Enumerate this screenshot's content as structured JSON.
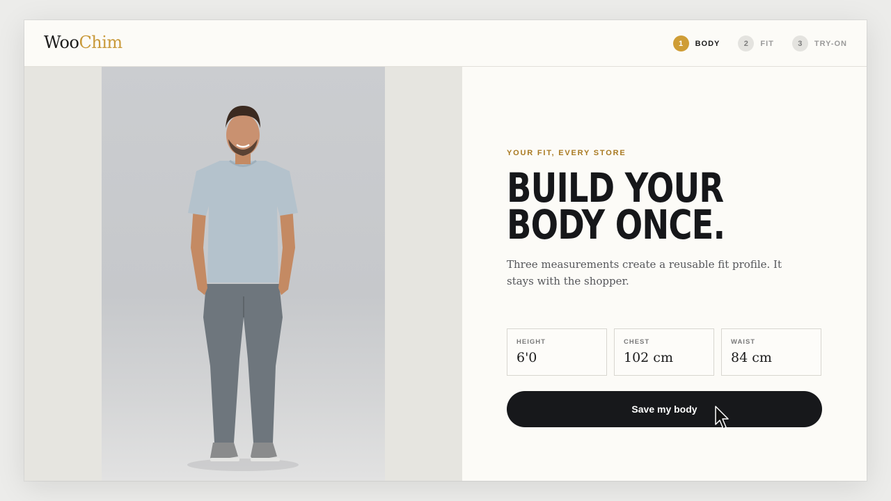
{
  "header": {
    "logo_primary": "Woo",
    "logo_accent": "Chim",
    "steps": [
      {
        "number": "1",
        "label": "BODY",
        "state": "active"
      },
      {
        "number": "2",
        "label": "FIT",
        "state": "inactive"
      },
      {
        "number": "3",
        "label": "TRY-ON",
        "state": "inactive"
      }
    ]
  },
  "main": {
    "eyebrow": "YOUR FIT, EVERY STORE",
    "headline_line1": "BUILD YOUR",
    "headline_line2": "BODY ONCE.",
    "subtext": "Three measurements create a reusable fit profile. It stays with the shopper.",
    "fields": [
      {
        "label": "HEIGHT",
        "value": "6'0"
      },
      {
        "label": "CHEST",
        "value": "102 cm"
      },
      {
        "label": "WAIST",
        "value": "84 cm"
      }
    ],
    "save_button": "Save my body"
  },
  "colors": {
    "accent": "#cf9d36",
    "eyebrow": "#a97a22",
    "button": "#17181b",
    "background": "#fcfbf7"
  },
  "icons": {
    "cursor": "arrow-cursor-icon",
    "photo": "model-photo"
  }
}
